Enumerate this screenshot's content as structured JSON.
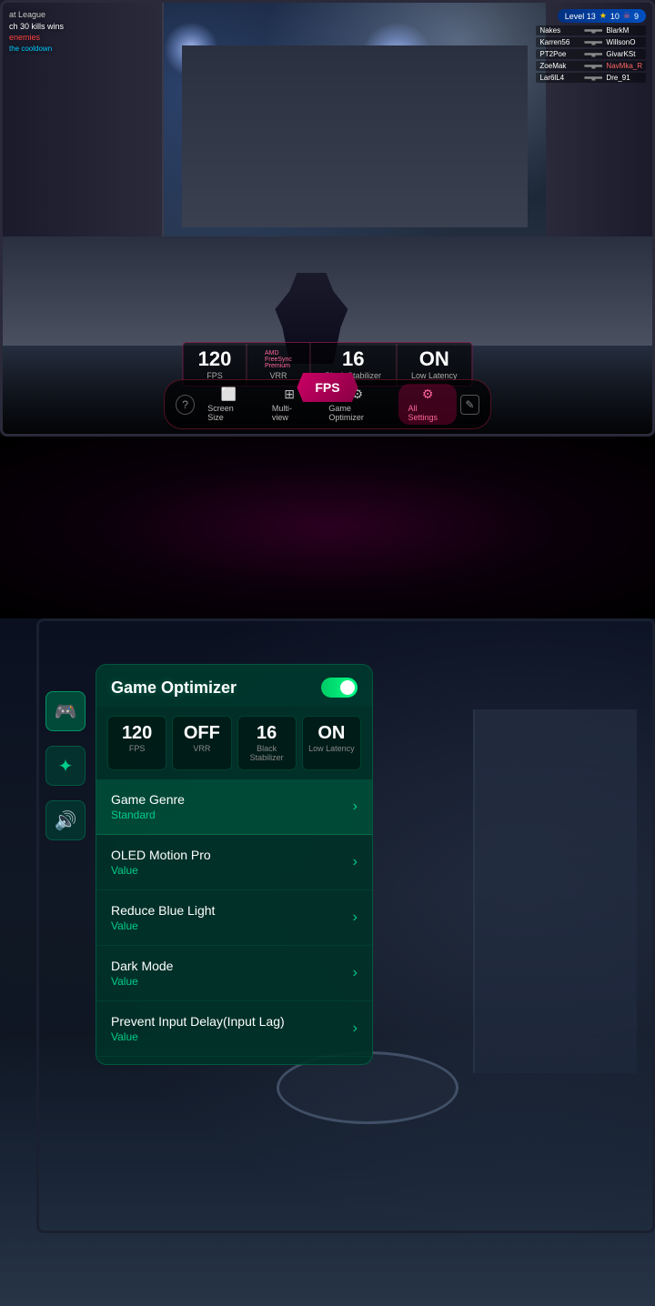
{
  "topSection": {
    "hud": {
      "league": "at League",
      "kills": "ch 30 kills wins",
      "enemies": "enemies",
      "cooldown": "the cooldown",
      "level": "Level 13",
      "stars": "10",
      "skulls": "9",
      "scoreboard": [
        {
          "name": "Nakes",
          "kills": "BlarkM"
        },
        {
          "name": "Karren56",
          "kills": "WillsonO"
        },
        {
          "name": "PT2Poe",
          "kills": "GivarKSt"
        },
        {
          "name": "ZoeMak",
          "kills": "NavMka_R"
        },
        {
          "name": "Lar6lL4",
          "kills": "Dre_91"
        }
      ]
    },
    "stats": {
      "fps_value": "120",
      "fps_label": "FPS",
      "vrr_value": "AMD FreeSync Premium",
      "vrr_label": "VRR",
      "center_label": "FPS",
      "bs_value": "16",
      "bs_label": "Black Stabilizer",
      "latency_value": "ON",
      "latency_label": "Low Latency"
    },
    "toolbar": {
      "help_symbol": "?",
      "screen_size_label": "Screen Size",
      "multiview_label": "Multi-view",
      "game_optimizer_label": "Game Optimizer",
      "all_settings_label": "All Settings",
      "edit_symbol": "✎"
    }
  },
  "bottomSection": {
    "sidebar": {
      "icons": [
        {
          "id": "gamepad",
          "symbol": "🎮",
          "active": true
        },
        {
          "id": "settings",
          "symbol": "✦",
          "active": false
        },
        {
          "id": "volume",
          "symbol": "🔊",
          "active": false
        }
      ]
    },
    "panel": {
      "title": "Game Optimizer",
      "toggle_on": true,
      "quickStats": {
        "fps": {
          "value": "120",
          "label": "FPS"
        },
        "vrr": {
          "value": "OFF",
          "label": "VRR"
        },
        "blackStabilizer": {
          "value": "16",
          "label": "Black Stabilizer"
        },
        "lowLatency": {
          "value": "ON",
          "label": "Low Latency"
        }
      },
      "menuItems": [
        {
          "id": "game-genre",
          "name": "Game Genre",
          "value": "Standard",
          "highlighted": true,
          "chevron": "›"
        },
        {
          "id": "oled-motion-pro",
          "name": "OLED Motion Pro",
          "value": "Value",
          "highlighted": false,
          "chevron": "›"
        },
        {
          "id": "reduce-blue-light",
          "name": "Reduce Blue Light",
          "value": "Value",
          "highlighted": false,
          "chevron": "›"
        },
        {
          "id": "dark-mode",
          "name": "Dark Mode",
          "value": "Value",
          "highlighted": false,
          "chevron": "›"
        },
        {
          "id": "prevent-input-delay",
          "name": "Prevent Input Delay(Input Lag)",
          "value": "Value",
          "highlighted": false,
          "chevron": "›"
        }
      ]
    }
  }
}
